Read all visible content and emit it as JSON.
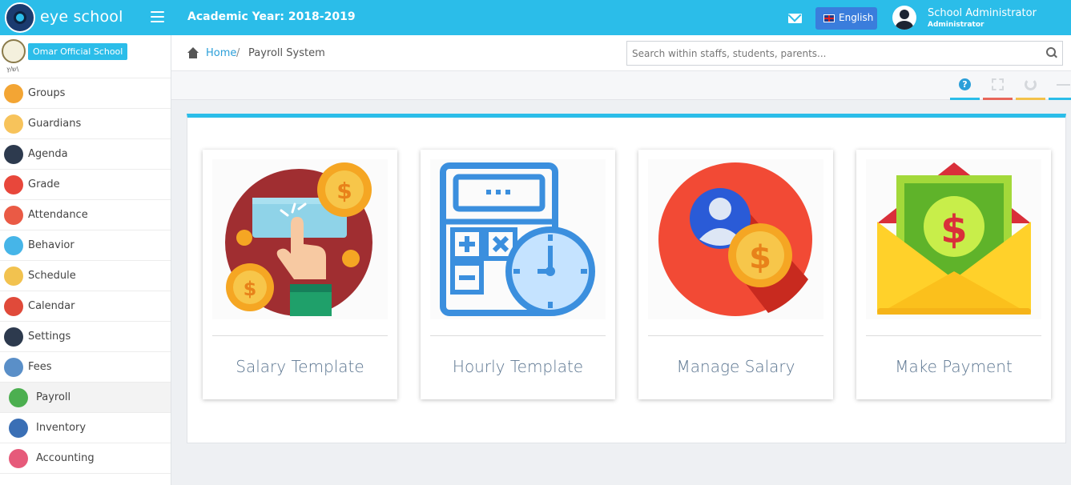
{
  "header": {
    "brand": "eye school",
    "academic_year": "Academic Year: 2018-2019",
    "language_button": "English",
    "user_name": "School Administrator",
    "user_role": "Administrator",
    "accent_color": "#2bbde9"
  },
  "sidebar": {
    "school_name": "Omar Official School",
    "school_sub": "ש/ץ\\",
    "items": [
      {
        "label": "Groups",
        "icon": "groups-icon",
        "color": "#f3a534"
      },
      {
        "label": "Guardians",
        "icon": "guardians-icon",
        "color": "#f7c35b"
      },
      {
        "label": "Agenda",
        "icon": "agenda-icon",
        "color": "#2d3a4e"
      },
      {
        "label": "Grade",
        "icon": "grade-icon",
        "color": "#e8473b"
      },
      {
        "label": "Attendance",
        "icon": "attendance-icon",
        "color": "#ea5a45"
      },
      {
        "label": "Behavior",
        "icon": "behavior-icon",
        "color": "#46b5e8"
      },
      {
        "label": "Schedule",
        "icon": "schedule-icon",
        "color": "#f2c24f"
      },
      {
        "label": "Calendar",
        "icon": "calendar-icon",
        "color": "#e04a3a"
      },
      {
        "label": "Settings",
        "icon": "settings-icon",
        "color": "#2d3a4e"
      },
      {
        "label": "Fees",
        "icon": "fees-icon",
        "color": "#5a8fc8"
      },
      {
        "label": "Payroll",
        "icon": "payroll-icon",
        "color": "#4caf50"
      },
      {
        "label": "Inventory",
        "icon": "inventory-icon",
        "color": "#3a6fb5"
      },
      {
        "label": "Accounting",
        "icon": "accounting-icon",
        "color": "#e65a7a"
      }
    ]
  },
  "breadcrumb": {
    "home": "Home",
    "separator": "/",
    "current": "Payroll System"
  },
  "search": {
    "placeholder": "Search within staffs, students, parents..."
  },
  "toolbar": {
    "help_label": "?",
    "tool_colors": [
      "#2bbde9",
      "#e8665a",
      "#f3c24a",
      "#2bbde9"
    ]
  },
  "cards": [
    {
      "title": "Salary Template",
      "icon": "salary-template-icon"
    },
    {
      "title": "Hourly Template",
      "icon": "hourly-template-icon"
    },
    {
      "title": "Manage Salary",
      "icon": "manage-salary-icon"
    },
    {
      "title": "Make Payment",
      "icon": "make-payment-icon"
    }
  ]
}
